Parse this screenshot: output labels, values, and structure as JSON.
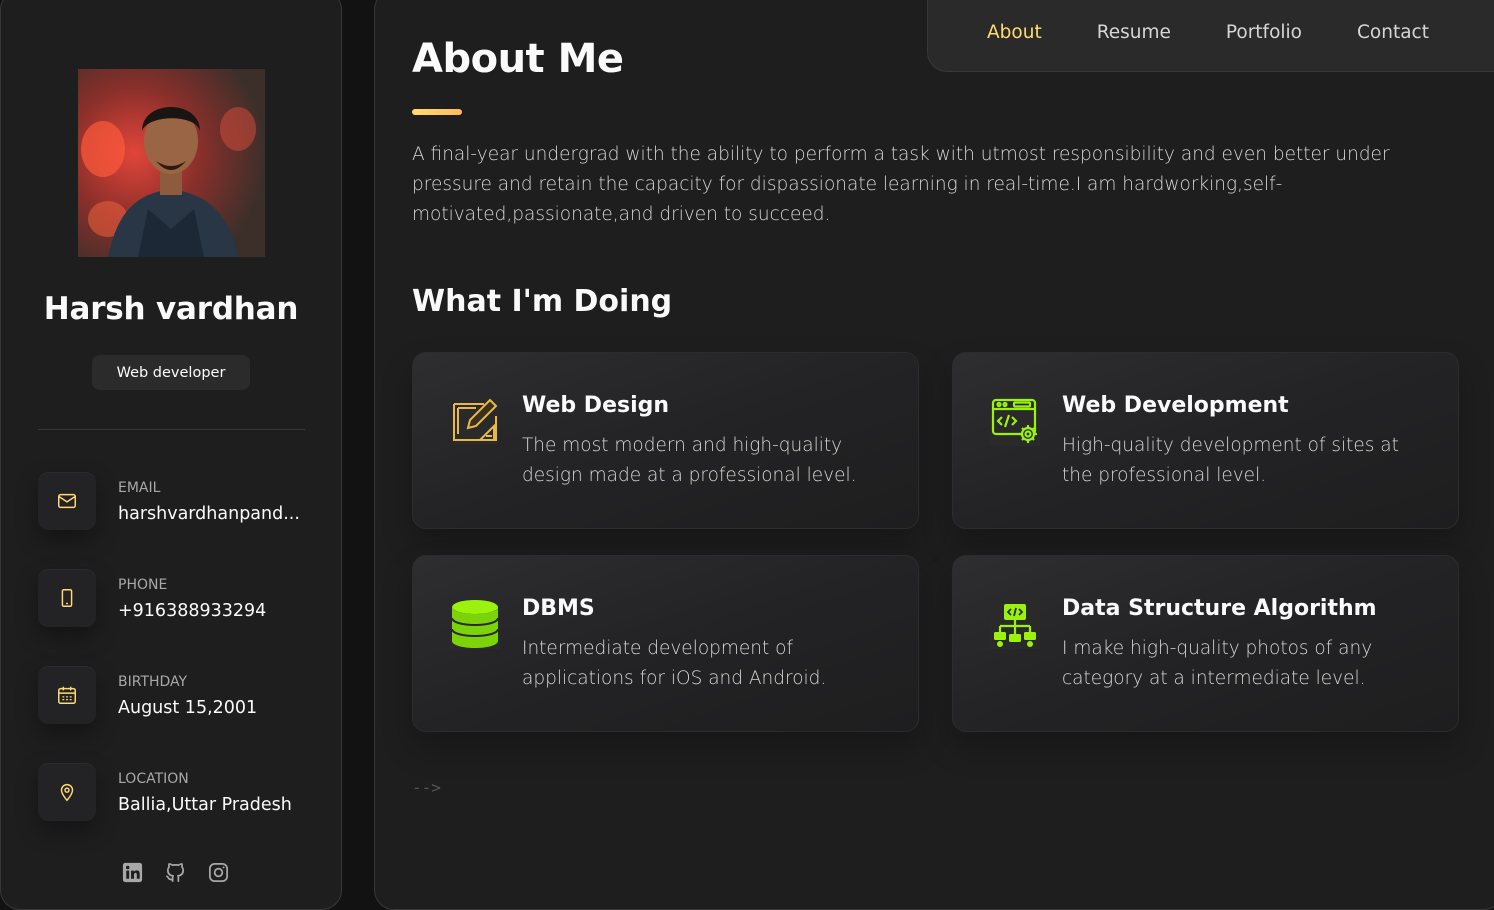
{
  "sidebar": {
    "name": "Harsh vardhan",
    "title": "Web developer",
    "contacts": [
      {
        "label": "EMAIL",
        "value": "harshvardhanpand...",
        "icon": "mail-icon"
      },
      {
        "label": "PHONE",
        "value": "+916388933294",
        "icon": "phone-icon"
      },
      {
        "label": "BIRTHDAY",
        "value": "August 15,2001",
        "icon": "calendar-icon"
      },
      {
        "label": "LOCATION",
        "value": "Ballia,Uttar Pradesh",
        "icon": "location-icon"
      }
    ],
    "socials": [
      "linkedin-icon",
      "github-icon",
      "instagram-icon"
    ]
  },
  "navbar": {
    "links": [
      "About",
      "Resume",
      "Portfolio",
      "Contact"
    ],
    "active": "About"
  },
  "about": {
    "title": "About Me",
    "text": "A final-year undergrad with the ability to perform a task with utmost responsibility and even better under pressure and retain the capacity for dispassionate learning in real-time.I am hardworking,self-motivated,passionate,and driven to succeed."
  },
  "services": {
    "title": "What I'm Doing",
    "items": [
      {
        "title": "Web Design",
        "text": "The most modern and high-quality design made at a professional level.",
        "icon": "design-icon"
      },
      {
        "title": "Web Development",
        "text": "High-quality development of sites at the professional level.",
        "icon": "dev-icon"
      },
      {
        "title": "DBMS",
        "text": "Intermediate development of applications for iOS and Android.",
        "icon": "database-icon"
      },
      {
        "title": "Data Structure Algorithm",
        "text": "I make high-quality photos of any category at a intermediate level.",
        "icon": "algorithm-icon"
      }
    ]
  },
  "stray_text": "-->",
  "colors": {
    "accent": "#ffdb70",
    "icon_green": "#9bf20d",
    "bg": "#1e1e1f"
  }
}
